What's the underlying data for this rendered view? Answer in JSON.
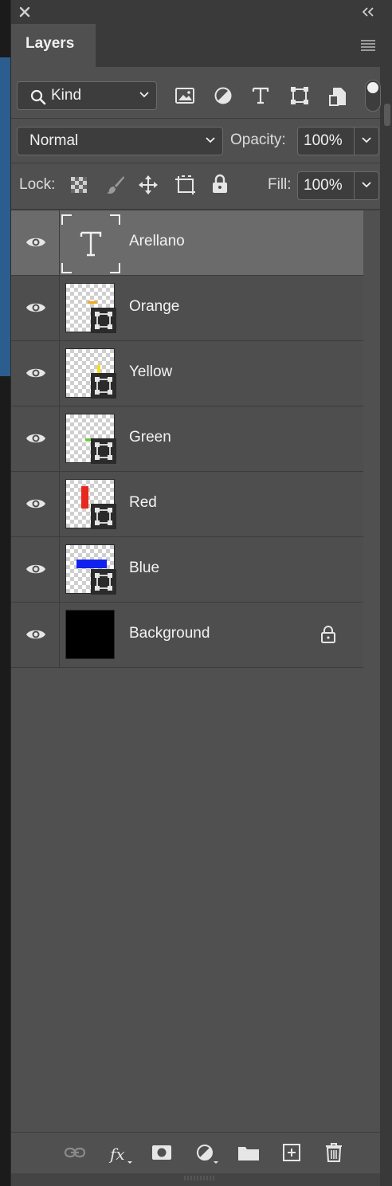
{
  "panel": {
    "tab_label": "Layers"
  },
  "filter": {
    "kind_label": "Kind",
    "icons": [
      "image-filter-icon",
      "adjustment-filter-icon",
      "type-filter-icon",
      "shape-filter-icon",
      "smart-object-filter-icon"
    ]
  },
  "blend": {
    "mode": "Normal",
    "opacity_label": "Opacity:",
    "opacity_value": "100%"
  },
  "lock": {
    "label": "Lock:",
    "icons": [
      "lock-transparent-icon",
      "lock-paint-icon",
      "lock-move-icon",
      "lock-artboard-icon",
      "lock-all-icon"
    ],
    "fill_label": "Fill:",
    "fill_value": "100%"
  },
  "layers": [
    {
      "name": "Arellano",
      "kind": "text",
      "selected": true
    },
    {
      "name": "Orange",
      "kind": "smart",
      "color": "#f2a81d"
    },
    {
      "name": "Yellow",
      "kind": "smart",
      "color": "#f4e01a"
    },
    {
      "name": "Green",
      "kind": "smart",
      "color": "#5fd12b"
    },
    {
      "name": "Red",
      "kind": "smart",
      "color": "#e8281e"
    },
    {
      "name": "Blue",
      "kind": "smart",
      "color": "#1122ee"
    },
    {
      "name": "Background",
      "kind": "background",
      "locked": true
    }
  ],
  "footer": {
    "icons": [
      "link-layers-icon",
      "fx-icon",
      "add-mask-icon",
      "adjustment-layer-icon",
      "new-group-icon",
      "new-layer-icon",
      "delete-layer-icon"
    ]
  }
}
